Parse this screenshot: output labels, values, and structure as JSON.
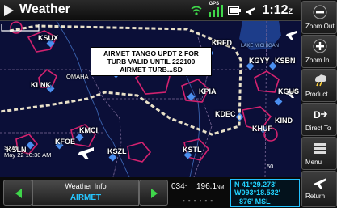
{
  "header": {
    "title": "Weather",
    "time": "1:12",
    "time_suffix": "Z",
    "gps_label": "GPS"
  },
  "map": {
    "labels": {
      "ksux": "KSUX",
      "krfd": "KRFD",
      "lake_michigan": "LAKE MICHIGAN",
      "kgyy": "KGYY",
      "ksbn": "KSBN",
      "omaha": "OMAHA",
      "klnk": "KLNK",
      "kpia": "KPIA",
      "kgus": "KGUS",
      "kdec": "KDEC",
      "kind": "KIND",
      "khuf": "KHUF",
      "kmci": "KMCI",
      "kfoe": "KFOE",
      "ksln": "KSLN",
      "kszl": "KSZL",
      "kstl": "KSTL"
    },
    "airmet_popup": [
      "AIRMET TANGO UPDT 2 FOR",
      "TURB VALID UNTIL 222100",
      "AIRMET TURB...SD"
    ],
    "sxm": {
      "source": "SXM",
      "timestamp": "May 22 10:30 AM"
    },
    "scale": "50"
  },
  "right_buttons": [
    {
      "label": "Zoom Out",
      "icon": "zoom-out-icon"
    },
    {
      "label": "Zoom In",
      "icon": "zoom-in-icon"
    },
    {
      "label": "Product",
      "icon": "product-icon"
    },
    {
      "label": "Direct To",
      "icon": "direct-to-icon"
    },
    {
      "label": "Menu",
      "icon": "menu-icon"
    },
    {
      "label": "Return",
      "icon": "return-icon"
    }
  ],
  "bottom": {
    "weather_info_title": "Weather Info",
    "weather_info_value": "AIRMET",
    "track": "034",
    "track_unit": "°",
    "distance": "196.1",
    "distance_unit": "NM",
    "dashes": "- - - - - -",
    "position": {
      "lat": "N 41°29.273'",
      "lon": "W093°18.532'",
      "alt": "876' MSL"
    }
  },
  "colors": {
    "accent": "#23d3ff",
    "airmet_border": "#e8e0c8",
    "airspace": "#d4226f",
    "airport": "#4b8ff0",
    "map_bg": "#0b0f38"
  }
}
